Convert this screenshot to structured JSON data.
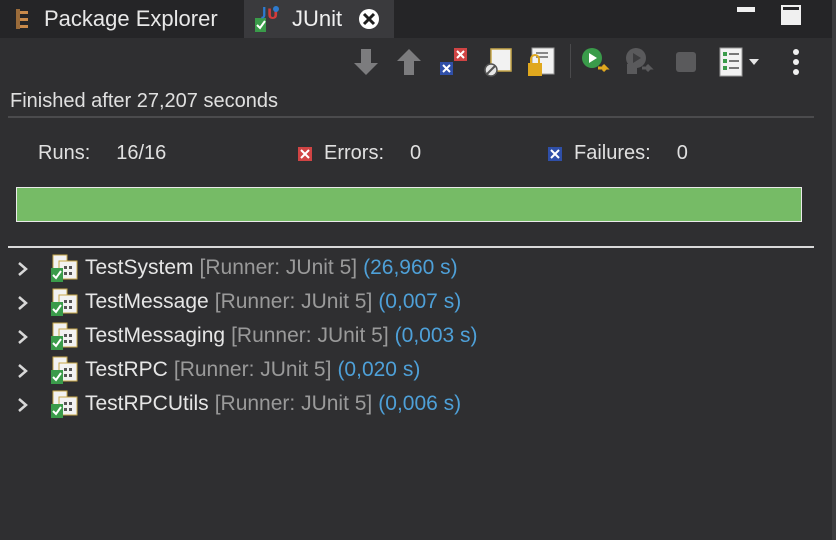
{
  "tabs": [
    {
      "label": "Package Explorer",
      "icon": "package-explorer-icon"
    },
    {
      "label": "JUnit",
      "icon": "junit-icon",
      "active": true
    }
  ],
  "toolbar": {
    "icons": [
      "next-failure-icon",
      "previous-failure-icon",
      "show-failures-only-icon",
      "show-skipped-icon",
      "scroll-lock-icon",
      "rerun-test-icon",
      "rerun-failed-first-icon",
      "stop-icon",
      "test-run-history-icon",
      "view-menu-icon"
    ]
  },
  "status": {
    "text": "Finished after 27,207 seconds"
  },
  "counters": {
    "runs_label": "Runs:",
    "runs_value": "16/16",
    "errors_label": "Errors:",
    "errors_value": "0",
    "failures_label": "Failures:",
    "failures_value": "0"
  },
  "progress": {
    "fraction": 1.0,
    "color": "#76bb66"
  },
  "tests": [
    {
      "name": "TestSystem",
      "runner": "[Runner: JUnit 5]",
      "time": "(26,960 s)"
    },
    {
      "name": "TestMessage",
      "runner": "[Runner: JUnit 5]",
      "time": "(0,007 s)"
    },
    {
      "name": "TestMessaging",
      "runner": "[Runner: JUnit 5]",
      "time": "(0,003 s)"
    },
    {
      "name": "TestRPC",
      "runner": "[Runner: JUnit 5]",
      "time": "(0,020 s)"
    },
    {
      "name": "TestRPCUtils",
      "runner": "[Runner: JUnit 5]",
      "time": "(0,006 s)"
    }
  ],
  "colors": {
    "pass": "#76bb66",
    "error": "#d04444",
    "failure": "#2f4fa8",
    "time": "#4ea0d8"
  }
}
